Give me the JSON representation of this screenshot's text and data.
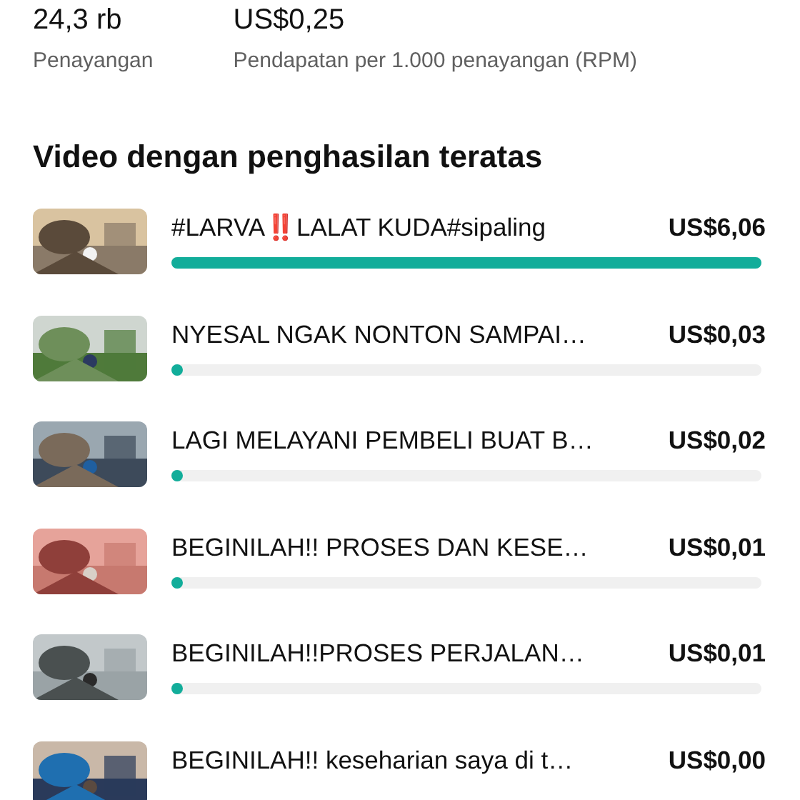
{
  "stats": [
    {
      "value": "24,3 rb",
      "label": "Penayangan"
    },
    {
      "value": "US$0,25",
      "label": "Pendapatan per 1.000 penayangan (RPM)"
    }
  ],
  "section_title": "Video dengan penghasilan teratas",
  "videos": [
    {
      "title": "#LARVA‼️LALAT KUDA#sipaling",
      "earnings": "US$6,06",
      "level": 1
    },
    {
      "title": "NYESAL NGAK NONTON SAMPAI…",
      "earnings": "US$0,03",
      "level": 0.005
    },
    {
      "title": "LAGI MELAYANI PEMBELI BUAT B…",
      "earnings": "US$0,02",
      "level": 0.003
    },
    {
      "title": "BEGINILAH!! PROSES DAN KESE…",
      "earnings": "US$0,01",
      "level": 0.002
    },
    {
      "title": "BEGINILAH!!PROSES PERJALAN…",
      "earnings": "US$0,01",
      "level": 0.002
    },
    {
      "title": "BEGINILAH!! keseharian saya di t…",
      "earnings": "US$0,00"
    }
  ]
}
